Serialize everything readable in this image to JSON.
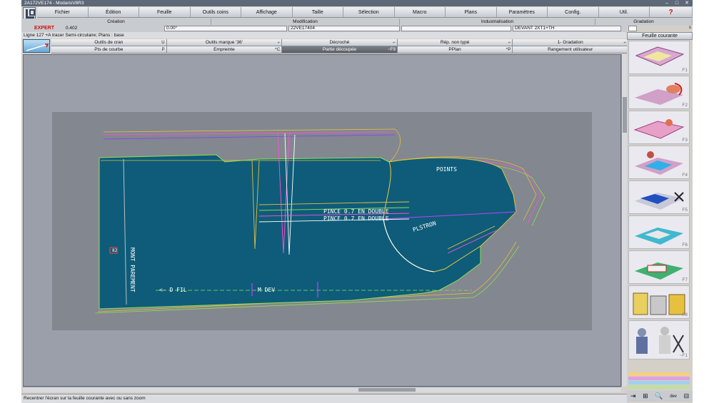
{
  "window": {
    "title": "2A172VE174 - ModarisV8R3",
    "minimize": "–",
    "maximize": "□",
    "close": "✕"
  },
  "menu": [
    "Fichier",
    "Édition",
    "Feuille",
    "Outils coins",
    "Affichage",
    "Taille",
    "Sélection",
    "Macro",
    "Plans",
    "Paramètres",
    "Config.",
    "Util."
  ],
  "help_icon": "?",
  "sections": {
    "creation": "Création",
    "modification": "Modification",
    "industrialisation": "Industrialisation",
    "gradation": "Gradation"
  },
  "info": {
    "mode": "EXPERT",
    "value": "0.402",
    "angle": "0.00°",
    "model": "22VE17404",
    "piece": "DEVANT 2XT1+TH"
  },
  "line_info": "Ligne 127 +A tracer   Semi-circulaire;   Plans :  base",
  "tools": [
    {
      "label": "Outils de cran",
      "key": "U"
    },
    {
      "label": "Outils marque '36'",
      "key": "⌐"
    },
    {
      "label": "Décroché",
      "key": "⌐"
    },
    {
      "label": "Rép. non typé",
      "key": "⌐"
    },
    {
      "label": "1- Gradation",
      "key": "⌐"
    },
    {
      "label": "Pts de courbe",
      "key": "P"
    },
    {
      "label": "Empreinte",
      "key": "^C"
    },
    {
      "label": "Partie découpée",
      "key": "~F9"
    },
    {
      "label": "PPlan",
      "key": "^P"
    },
    {
      "label": "Rangement utilisateur",
      "key": ""
    }
  ],
  "right_panel": {
    "title": "Feuille courante",
    "scale": "s",
    "keys": [
      "F1",
      "F2",
      "F3",
      "F4",
      "F5",
      "F6",
      "F7",
      "F8",
      "~F1"
    ]
  },
  "canvas_labels": {
    "parement": "MONT PAREMENT",
    "dfil": "<- D FIL",
    "mdev": "M DEV",
    "plastron": "PLSTRON",
    "pince": "PINCE 0.7 EN DOUBLE",
    "pts": "POINTS",
    "ref": "82"
  },
  "bottom_icons": [
    "⇥",
    "⊞",
    "🔍",
    "dev",
    "⊟"
  ],
  "status": "Recentrer l'écran sur la feuille courante avec ou sans zoom",
  "colors": {
    "piece_fill": "#0e5c79",
    "canvas_bg": "#9b9fa9",
    "sheet_bg": "#83878f"
  }
}
